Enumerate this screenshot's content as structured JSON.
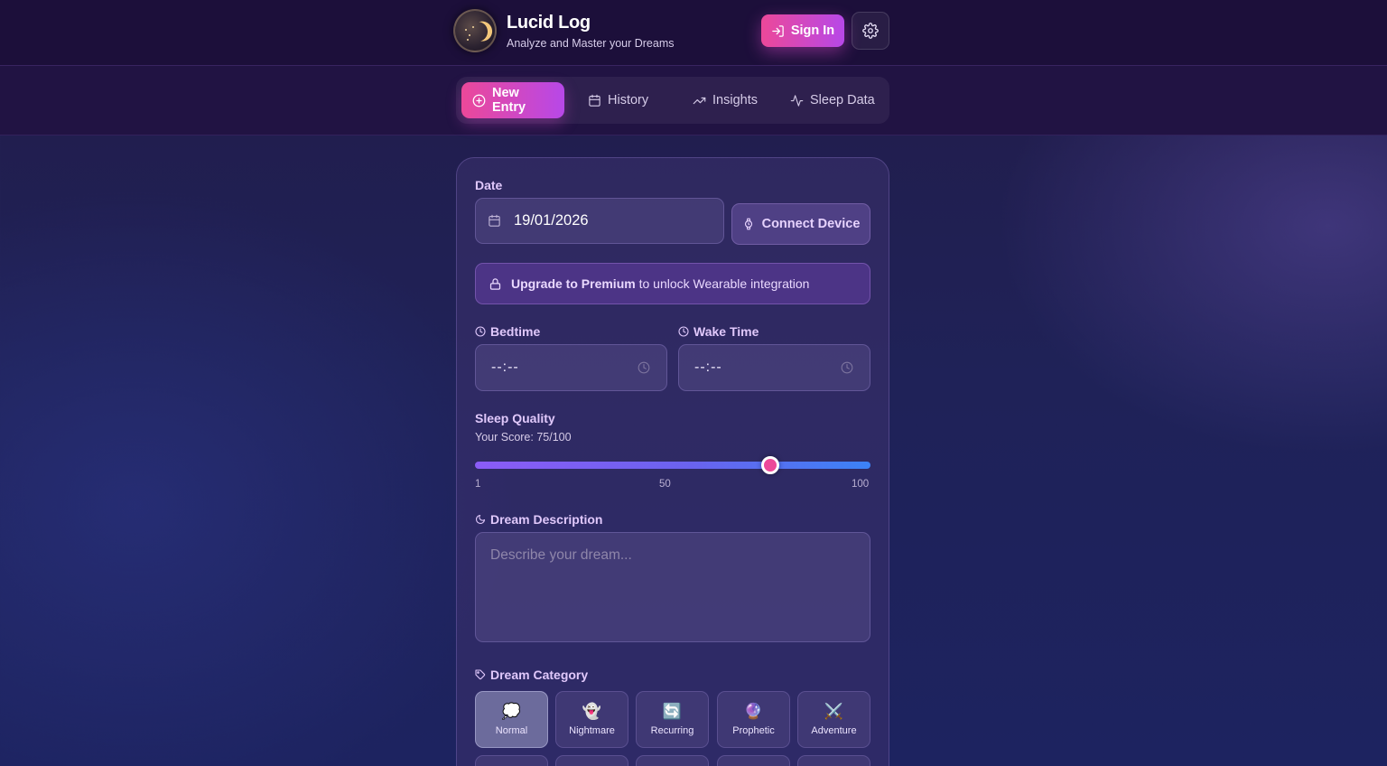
{
  "header": {
    "title": "Lucid Log",
    "subtitle": "Analyze and Master your Dreams",
    "signin_label": "Sign In"
  },
  "nav": {
    "tabs": [
      {
        "label": "New Entry",
        "icon": "plus-circle-icon",
        "active": true
      },
      {
        "label": "History",
        "icon": "calendar-icon",
        "active": false
      },
      {
        "label": "Insights",
        "icon": "trending-up-icon",
        "active": false
      },
      {
        "label": "Sleep Data",
        "icon": "activity-icon",
        "active": false
      }
    ]
  },
  "form": {
    "date": {
      "label": "Date",
      "value": "19/01/2026"
    },
    "connect_device_label": "Connect Device",
    "premium": {
      "strong": "Upgrade to Premium",
      "rest": "to unlock Wearable integration"
    },
    "bedtime": {
      "label": "Bedtime",
      "value": "--:--"
    },
    "wake_time": {
      "label": "Wake Time",
      "value": "--:--"
    },
    "sleep_quality": {
      "label": "Sleep Quality",
      "score_text": "Your Score: 75/100",
      "value": 75,
      "min": 1,
      "max": 100,
      "ticks": [
        "1",
        "50",
        "100"
      ]
    },
    "dream_description": {
      "label": "Dream Description",
      "placeholder": "Describe your dream..."
    },
    "dream_category": {
      "label": "Dream Category",
      "options": [
        {
          "label": "Normal",
          "emoji": "💭",
          "selected": true
        },
        {
          "label": "Nightmare",
          "emoji": "👻",
          "selected": false
        },
        {
          "label": "Recurring",
          "emoji": "🔄",
          "selected": false
        },
        {
          "label": "Prophetic",
          "emoji": "🔮",
          "selected": false
        },
        {
          "label": "Adventure",
          "emoji": "⚔️",
          "selected": false
        }
      ]
    }
  },
  "colors": {
    "accent_pink": "#ec4899",
    "accent_purple": "#b748e8",
    "label_lilac": "#e0c8fb"
  }
}
